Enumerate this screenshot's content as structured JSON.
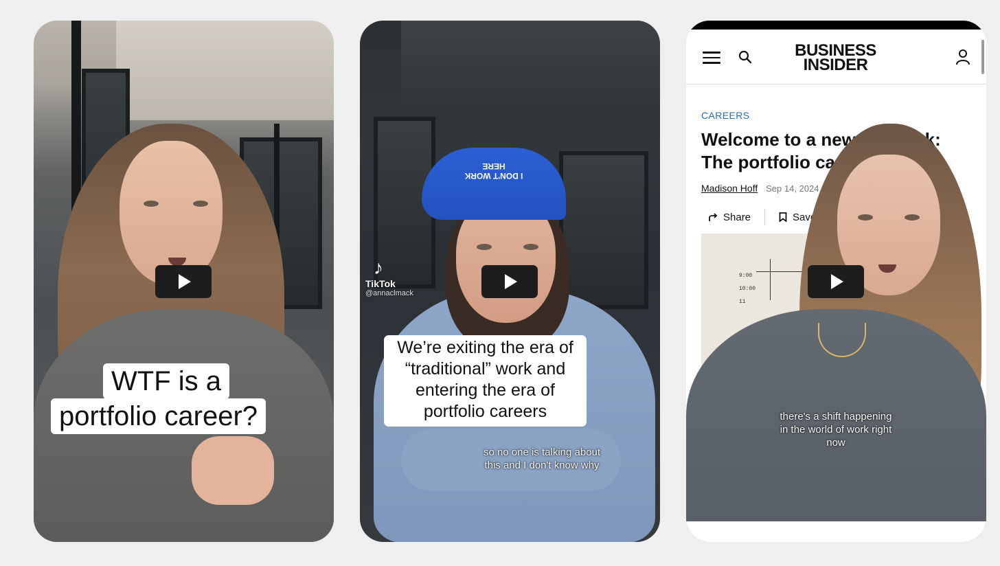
{
  "video1": {
    "caption_line1": "WTF is a",
    "caption_line2": "portfolio career?"
  },
  "video2": {
    "watermark_brand": "TikTok",
    "watermark_handle": "@annaclmack",
    "caption": "We’re exiting the era of “traditional” work and entering the era of portfolio careers",
    "subtitle_line1": "so no one is talking about",
    "subtitle_line2": "this and I don't know why",
    "hat_text": "I DON'T WORK HERE"
  },
  "video3": {
    "site_logo_line1": "BUSINESS",
    "site_logo_line2": "INSIDER",
    "category": "CAREERS",
    "headline_line1": "Welcome to a new",
    "headline_line1_end": "work:",
    "headline_line2": "The portfolio ca",
    "author": "Madison Hoff",
    "date": "Sep 14, 2024,",
    "share_label": "Share",
    "save_label": "Save",
    "schedule_times": [
      "9:00",
      "10:00",
      "11"
    ],
    "subtitle_line1": "there's a shift happening",
    "subtitle_line2": "in the world of work right",
    "subtitle_line3": "now"
  },
  "icons": [
    "play-icon",
    "tiktok-icon",
    "menu-icon",
    "search-icon",
    "user-icon",
    "share-icon",
    "bookmark-icon"
  ]
}
